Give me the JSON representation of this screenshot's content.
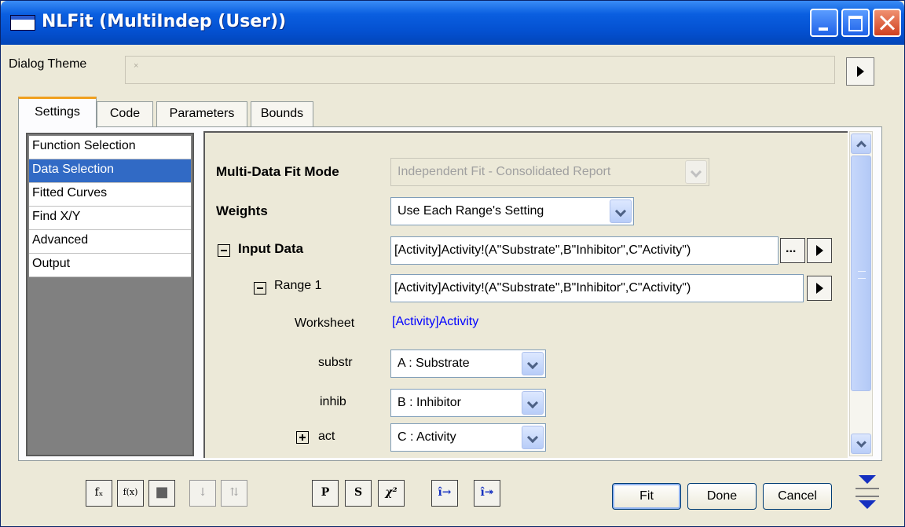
{
  "window": {
    "title": "NLFit (MultiIndep (User))"
  },
  "theme": {
    "label": "Dialog Theme",
    "value": "×"
  },
  "tabs": [
    {
      "label": "Settings",
      "active": true
    },
    {
      "label": "Code",
      "active": false
    },
    {
      "label": "Parameters",
      "active": false
    },
    {
      "label": "Bounds",
      "active": false
    }
  ],
  "nav": {
    "items": [
      {
        "label": "Function Selection"
      },
      {
        "label": "Data Selection"
      },
      {
        "label": "Fitted Curves"
      },
      {
        "label": "Find X/Y"
      },
      {
        "label": "Advanced"
      },
      {
        "label": "Output"
      }
    ],
    "selected": "Data Selection"
  },
  "form": {
    "fit_mode": {
      "label": "Multi-Data Fit Mode",
      "value": "Independent Fit - Consolidated Report"
    },
    "weights": {
      "label": "Weights",
      "value": "Use Each Range's Setting"
    },
    "input_data": {
      "label": "Input Data",
      "value": "[Activity]Activity!(A\"Substrate\",B\"Inhibitor\",C\"Activity\")",
      "browse": "..."
    },
    "range1": {
      "label": "Range 1",
      "value": "[Activity]Activity!(A\"Substrate\",B\"Inhibitor\",C\"Activity\")"
    },
    "worksheet": {
      "label": "Worksheet",
      "value": "[Activity]Activity"
    },
    "substr": {
      "label": "substr",
      "value": "A : Substrate"
    },
    "inhib": {
      "label": "inhib",
      "value": "B : Inhibitor"
    },
    "act": {
      "label": "act",
      "value": "C : Activity"
    }
  },
  "toolbar": [
    {
      "name": "fx-settings-icon",
      "glyph": "fₓ",
      "enabled": true
    },
    {
      "name": "function-builder-icon",
      "glyph": "f(x)",
      "enabled": true
    },
    {
      "name": "save-icon",
      "glyph": "■",
      "enabled": true
    },
    {
      "name": "sort-down-icon",
      "glyph": "↓",
      "enabled": false
    },
    {
      "name": "expand-icon",
      "glyph": "⇅",
      "enabled": false
    },
    {
      "name": "parameter-initialize-icon",
      "glyph": "P",
      "enabled": true
    },
    {
      "name": "simplex-icon",
      "glyph": "S",
      "enabled": true
    },
    {
      "name": "chi-square-icon",
      "glyph": "χ²",
      "enabled": true
    },
    {
      "name": "one-iteration-icon",
      "glyph": "î→",
      "enabled": true
    },
    {
      "name": "fit-until-converged-icon",
      "glyph": "î↠",
      "enabled": true
    }
  ],
  "buttons": {
    "fit": "Fit",
    "done": "Done",
    "cancel": "Cancel"
  },
  "colors": {
    "titlebar": "#0450d0",
    "selection": "#316ac5",
    "link": "#0000ff",
    "dialog_bg": "#ece9d8"
  }
}
